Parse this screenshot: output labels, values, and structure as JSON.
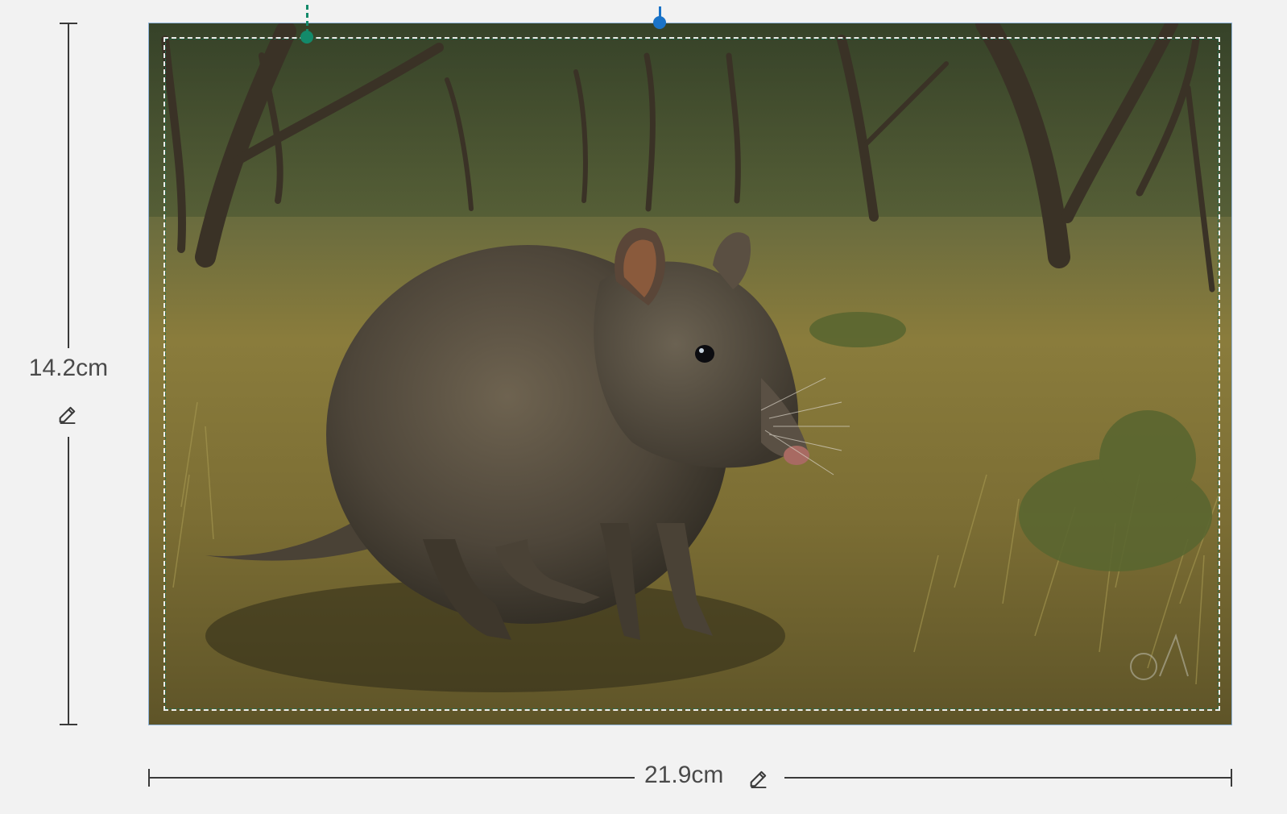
{
  "dimensions": {
    "height_label": "14.2cm",
    "width_label": "21.9cm"
  },
  "icons": {
    "edit_height": "pencil-icon",
    "edit_width": "pencil-icon"
  },
  "image": {
    "subject": "bandicoot-in-grassland-photo"
  },
  "colors": {
    "background": "#f2f2f2",
    "ruler": "#3a3a3a",
    "label": "#4a4a4a",
    "frame_border": "#8fb3d9",
    "safe_zone_handle": "#138a6a",
    "rotate_handle": "#1a73c8"
  }
}
